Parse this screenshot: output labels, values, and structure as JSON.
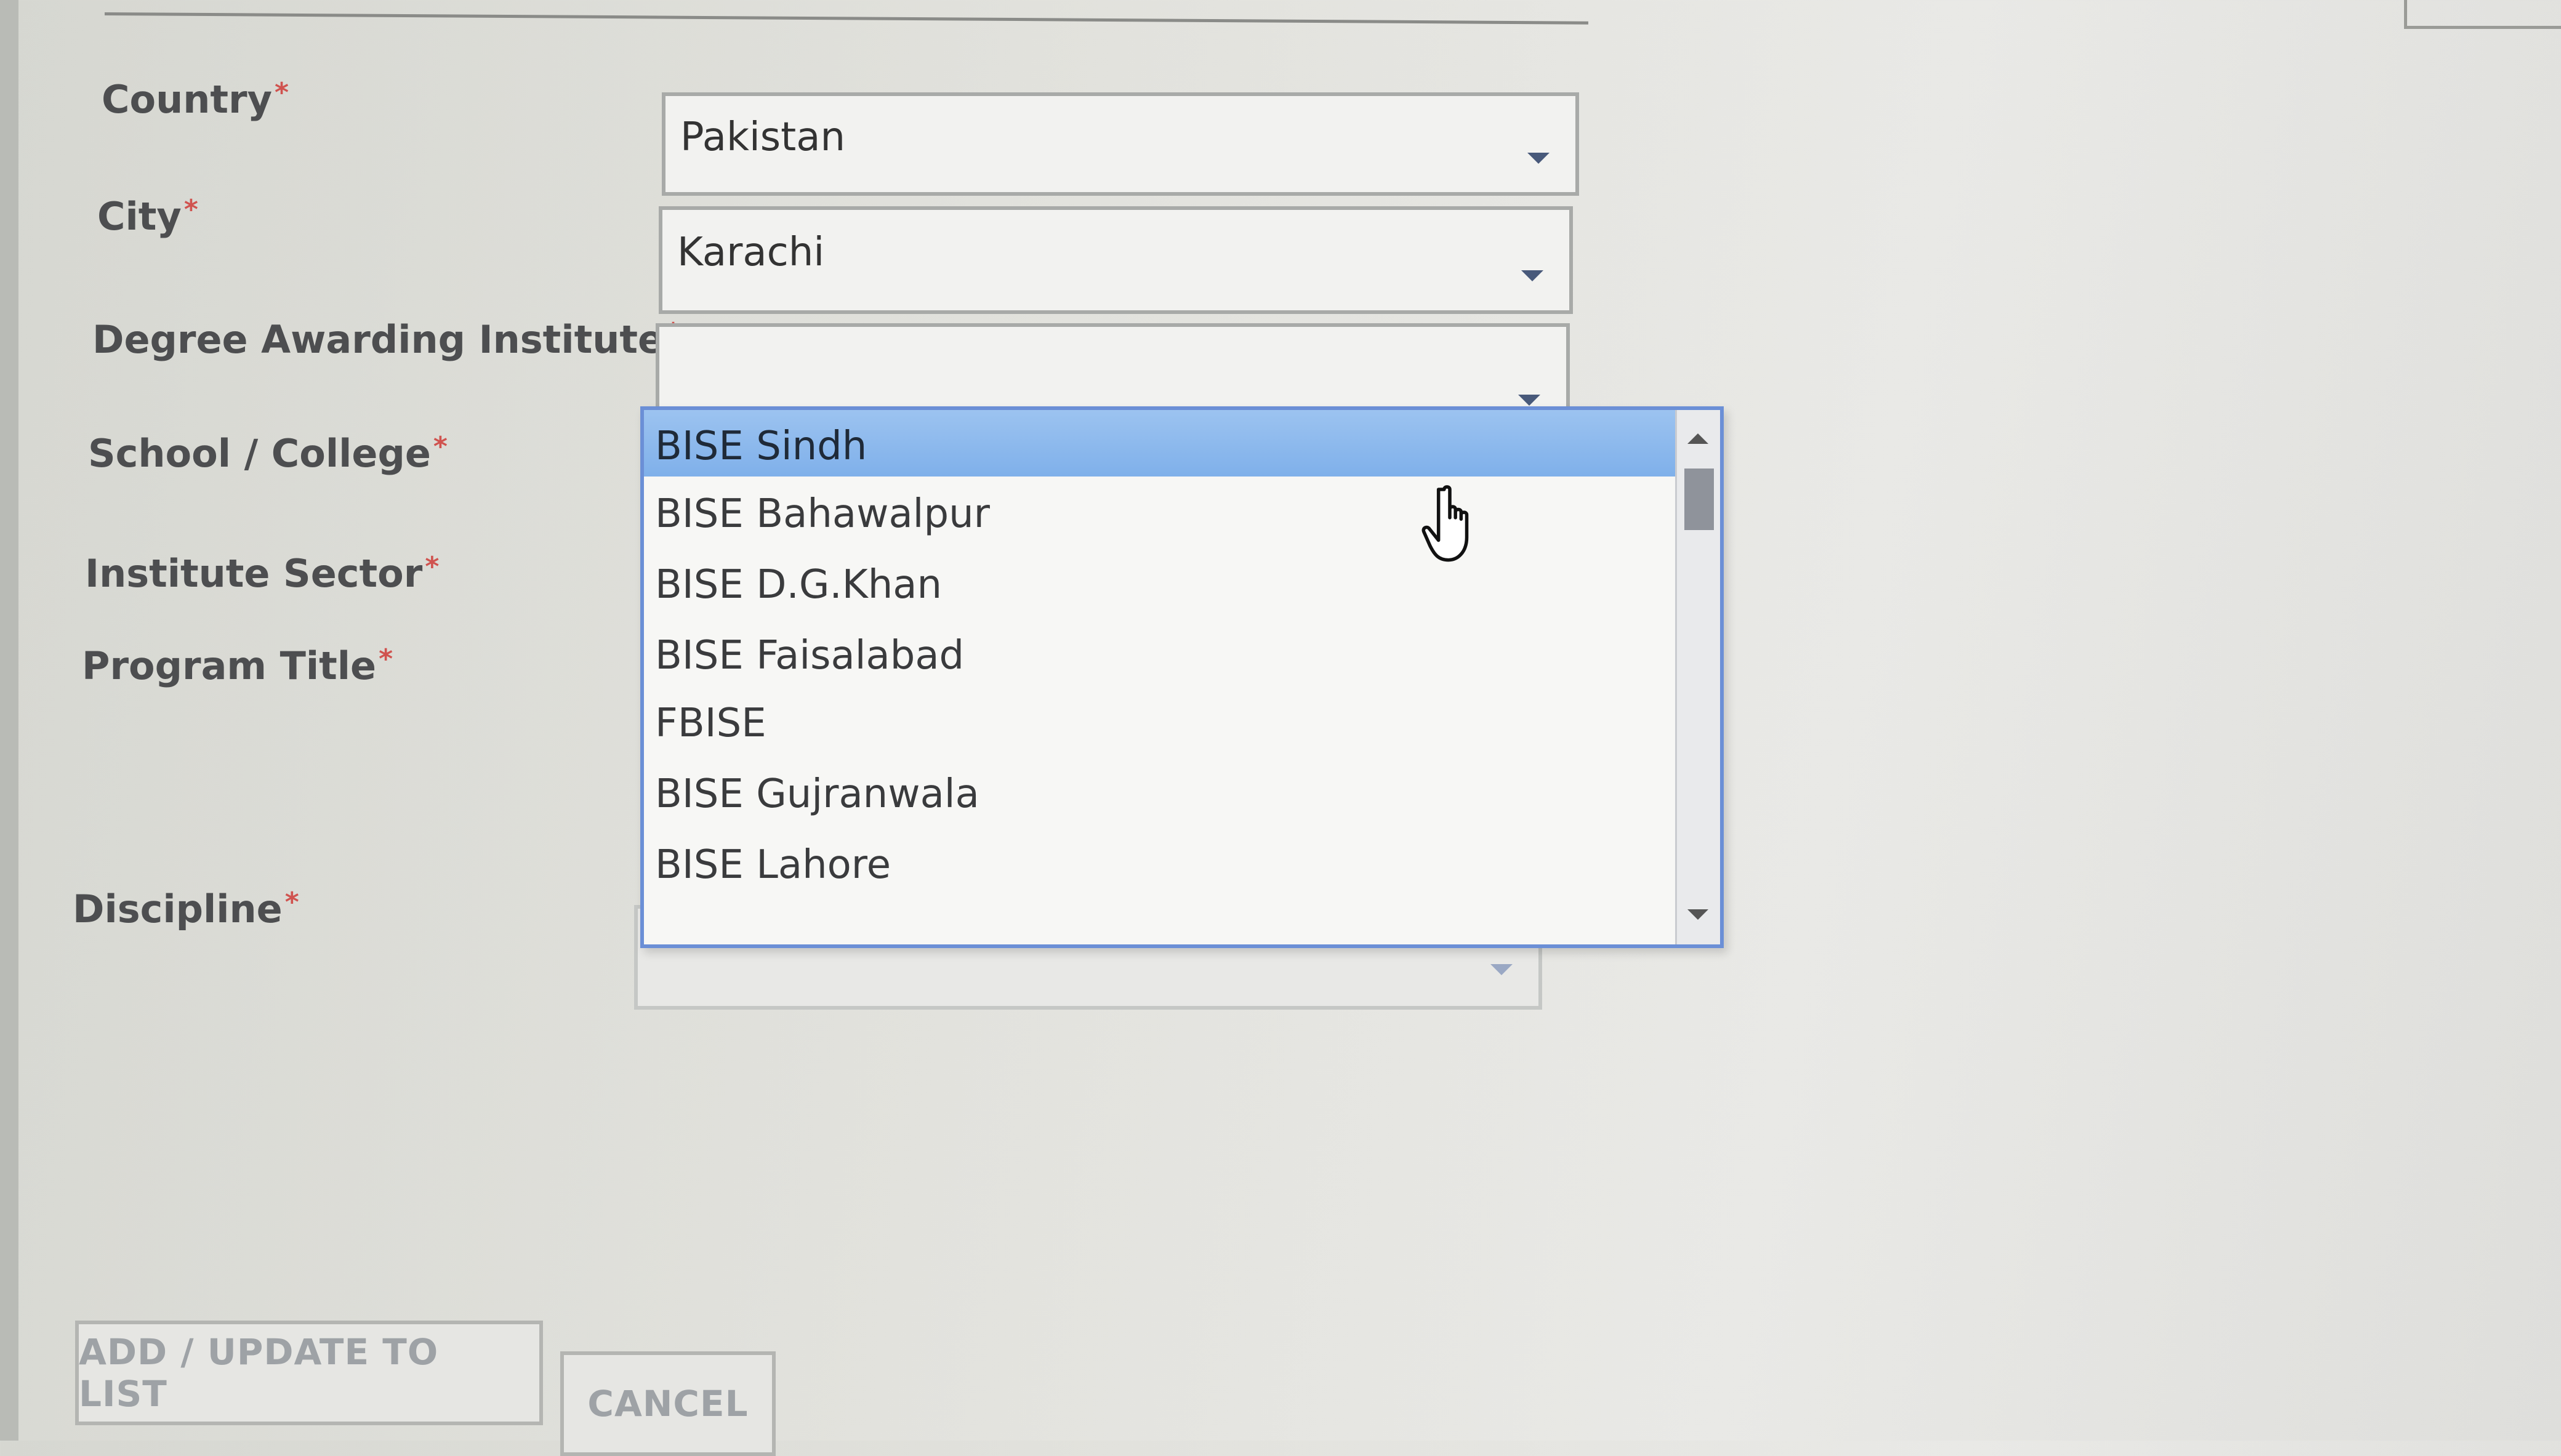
{
  "form": {
    "fields": [
      {
        "label": "Country",
        "required": "*",
        "value": "Pakistan"
      },
      {
        "label": "City",
        "required": "*",
        "value": "Karachi"
      },
      {
        "label": "Degree Awarding Institute",
        "required": "*",
        "value": ""
      },
      {
        "label": "School / College",
        "required": "*"
      },
      {
        "label": "Institute Sector",
        "required": "*"
      },
      {
        "label": "Program Title",
        "required": "*"
      },
      {
        "label": "Discipline",
        "required": "*",
        "value": ""
      }
    ]
  },
  "dropdown": {
    "highlighted": "BISE Sindh",
    "options": [
      "BISE Sindh",
      "BISE Bahawalpur",
      "BISE D.G.Khan",
      "BISE Faisalabad",
      "FBISE",
      "BISE Gujranwala",
      "BISE Lahore"
    ]
  },
  "buttons": {
    "add_update": "ADD / UPDATE TO LIST",
    "cancel": "CANCEL"
  },
  "colors": {
    "required_mark": "#d0534f",
    "highlight": "#8fbaf0",
    "dropdown_border": "#6b8fd6"
  }
}
